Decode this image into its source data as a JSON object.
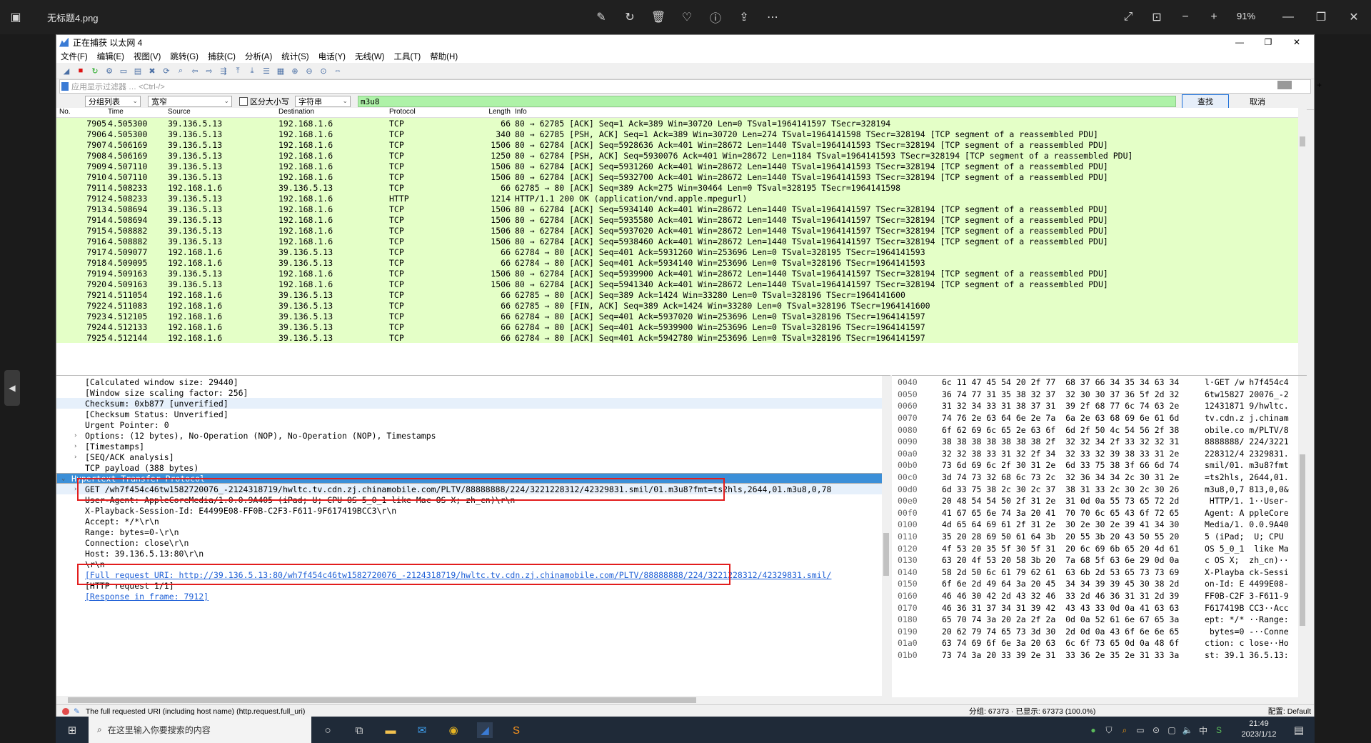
{
  "viewer": {
    "title": "无标题4.png",
    "zoom": "91%"
  },
  "window": {
    "title": "正在捕获 以太网 4"
  },
  "menu": [
    "文件(F)",
    "编辑(E)",
    "视图(V)",
    "跳转(G)",
    "捕获(C)",
    "分析(A)",
    "统计(S)",
    "电话(Y)",
    "无线(W)",
    "工具(T)",
    "帮助(H)"
  ],
  "filter": {
    "placeholder": "应用显示过滤器 … <Ctrl-/>"
  },
  "find": {
    "scope": "分组列表",
    "width": "宽窄",
    "case_label": "区分大小写",
    "type": "字符串",
    "value": "m3u8",
    "find_btn": "查找",
    "cancel_btn": "取消"
  },
  "columns": [
    "No.",
    "Time",
    "Source",
    "Destination",
    "Protocol",
    "Length",
    "Info"
  ],
  "packets": [
    [
      "7905",
      "4.505300",
      "39.136.5.13",
      "192.168.1.6",
      "TCP",
      "66",
      "80 → 62785 [ACK] Seq=1 Ack=389 Win=30720 Len=0 TSval=1964141597 TSecr=328194"
    ],
    [
      "7906",
      "4.505300",
      "39.136.5.13",
      "192.168.1.6",
      "TCP",
      "340",
      "80 → 62785 [PSH, ACK] Seq=1 Ack=389 Win=30720 Len=274 TSval=1964141598 TSecr=328194 [TCP segment of a reassembled PDU]"
    ],
    [
      "7907",
      "4.506169",
      "39.136.5.13",
      "192.168.1.6",
      "TCP",
      "1506",
      "80 → 62784 [ACK] Seq=5928636 Ack=401 Win=28672 Len=1440 TSval=1964141593 TSecr=328194 [TCP segment of a reassembled PDU]"
    ],
    [
      "7908",
      "4.506169",
      "39.136.5.13",
      "192.168.1.6",
      "TCP",
      "1250",
      "80 → 62784 [PSH, ACK] Seq=5930076 Ack=401 Win=28672 Len=1184 TSval=1964141593 TSecr=328194 [TCP segment of a reassembled PDU]"
    ],
    [
      "7909",
      "4.507110",
      "39.136.5.13",
      "192.168.1.6",
      "TCP",
      "1506",
      "80 → 62784 [ACK] Seq=5931260 Ack=401 Win=28672 Len=1440 TSval=1964141593 TSecr=328194 [TCP segment of a reassembled PDU]"
    ],
    [
      "7910",
      "4.507110",
      "39.136.5.13",
      "192.168.1.6",
      "TCP",
      "1506",
      "80 → 62784 [ACK] Seq=5932700 Ack=401 Win=28672 Len=1440 TSval=1964141593 TSecr=328194 [TCP segment of a reassembled PDU]"
    ],
    [
      "7911",
      "4.508233",
      "192.168.1.6",
      "39.136.5.13",
      "TCP",
      "66",
      "62785 → 80 [ACK] Seq=389 Ack=275 Win=30464 Len=0 TSval=328195 TSecr=1964141598"
    ],
    [
      "7912",
      "4.508233",
      "39.136.5.13",
      "192.168.1.6",
      "HTTP",
      "1214",
      "HTTP/1.1 200 OK  (application/vnd.apple.mpegurl)"
    ],
    [
      "7913",
      "4.508694",
      "39.136.5.13",
      "192.168.1.6",
      "TCP",
      "1506",
      "80 → 62784 [ACK] Seq=5934140 Ack=401 Win=28672 Len=1440 TSval=1964141597 TSecr=328194 [TCP segment of a reassembled PDU]"
    ],
    [
      "7914",
      "4.508694",
      "39.136.5.13",
      "192.168.1.6",
      "TCP",
      "1506",
      "80 → 62784 [ACK] Seq=5935580 Ack=401 Win=28672 Len=1440 TSval=1964141597 TSecr=328194 [TCP segment of a reassembled PDU]"
    ],
    [
      "7915",
      "4.508882",
      "39.136.5.13",
      "192.168.1.6",
      "TCP",
      "1506",
      "80 → 62784 [ACK] Seq=5937020 Ack=401 Win=28672 Len=1440 TSval=1964141597 TSecr=328194 [TCP segment of a reassembled PDU]"
    ],
    [
      "7916",
      "4.508882",
      "39.136.5.13",
      "192.168.1.6",
      "TCP",
      "1506",
      "80 → 62784 [ACK] Seq=5938460 Ack=401 Win=28672 Len=1440 TSval=1964141597 TSecr=328194 [TCP segment of a reassembled PDU]"
    ],
    [
      "7917",
      "4.509077",
      "192.168.1.6",
      "39.136.5.13",
      "TCP",
      "66",
      "62784 → 80 [ACK] Seq=401 Ack=5931260 Win=253696 Len=0 TSval=328195 TSecr=1964141593"
    ],
    [
      "7918",
      "4.509095",
      "192.168.1.6",
      "39.136.5.13",
      "TCP",
      "66",
      "62784 → 80 [ACK] Seq=401 Ack=5934140 Win=253696 Len=0 TSval=328196 TSecr=1964141593"
    ],
    [
      "7919",
      "4.509163",
      "39.136.5.13",
      "192.168.1.6",
      "TCP",
      "1506",
      "80 → 62784 [ACK] Seq=5939900 Ack=401 Win=28672 Len=1440 TSval=1964141597 TSecr=328194 [TCP segment of a reassembled PDU]"
    ],
    [
      "7920",
      "4.509163",
      "39.136.5.13",
      "192.168.1.6",
      "TCP",
      "1506",
      "80 → 62784 [ACK] Seq=5941340 Ack=401 Win=28672 Len=1440 TSval=1964141597 TSecr=328194 [TCP segment of a reassembled PDU]"
    ],
    [
      "7921",
      "4.511054",
      "192.168.1.6",
      "39.136.5.13",
      "TCP",
      "66",
      "62785 → 80 [ACK] Seq=389 Ack=1424 Win=33280 Len=0 TSval=328196 TSecr=1964141600"
    ],
    [
      "7922",
      "4.511083",
      "192.168.1.6",
      "39.136.5.13",
      "TCP",
      "66",
      "62785 → 80 [FIN, ACK] Seq=389 Ack=1424 Win=33280 Len=0 TSval=328196 TSecr=1964141600"
    ],
    [
      "7923",
      "4.512105",
      "192.168.1.6",
      "39.136.5.13",
      "TCP",
      "66",
      "62784 → 80 [ACK] Seq=401 Ack=5937020 Win=253696 Len=0 TSval=328196 TSecr=1964141597"
    ],
    [
      "7924",
      "4.512133",
      "192.168.1.6",
      "39.136.5.13",
      "TCP",
      "66",
      "62784 → 80 [ACK] Seq=401 Ack=5939900 Win=253696 Len=0 TSval=328196 TSecr=1964141597"
    ],
    [
      "7925",
      "4.512144",
      "192.168.1.6",
      "39.136.5.13",
      "TCP",
      "66",
      "62784 → 80 [ACK] Seq=401 Ack=5942780 Win=253696 Len=0 TSval=328196 TSecr=1964141597"
    ]
  ],
  "details": [
    {
      "indent": 1,
      "expand": "",
      "text": "[Calculated window size: 29440]"
    },
    {
      "indent": 1,
      "expand": "",
      "text": "[Window size scaling factor: 256]"
    },
    {
      "indent": 1,
      "expand": "",
      "text": "Checksum: 0xb877 [unverified]",
      "style": "hl"
    },
    {
      "indent": 1,
      "expand": "",
      "text": "[Checksum Status: Unverified]"
    },
    {
      "indent": 1,
      "expand": "",
      "text": "Urgent Pointer: 0"
    },
    {
      "indent": 1,
      "expand": ">",
      "text": "Options: (12 bytes), No-Operation (NOP), No-Operation (NOP), Timestamps"
    },
    {
      "indent": 1,
      "expand": ">",
      "text": "[Timestamps]"
    },
    {
      "indent": 1,
      "expand": ">",
      "text": "[SEQ/ACK analysis]"
    },
    {
      "indent": 1,
      "expand": "",
      "text": "TCP payload (388 bytes)"
    },
    {
      "indent": 0,
      "expand": "v",
      "text": "Hypertext Transfer Protocol",
      "style": "sel"
    },
    {
      "indent": 1,
      "expand": ">",
      "text": "GET /wh7f454c46tw1582720076_-2124318719/hwltc.tv.cdn.zj.chinamobile.com/PLTV/88888888/224/3221228312/42329831.smil/01.m3u8?fmt=ts2hls,2644,01.m3u8,0,78",
      "style": "hl"
    },
    {
      "indent": 1,
      "expand": "",
      "text": "User-Agent: AppleCoreMedia/1.0.0.9A405 (iPad; U; CPU OS 5_0_1 like Mac OS X; zh_cn)\\r\\n"
    },
    {
      "indent": 1,
      "expand": "",
      "text": "X-Playback-Session-Id: E4499E08-FF0B-C2F3-F611-9F617419BCC3\\r\\n"
    },
    {
      "indent": 1,
      "expand": "",
      "text": "Accept: */*\\r\\n"
    },
    {
      "indent": 1,
      "expand": "",
      "text": "Range: bytes=0-\\r\\n"
    },
    {
      "indent": 1,
      "expand": "",
      "text": "Connection: close\\r\\n"
    },
    {
      "indent": 1,
      "expand": "",
      "text": "Host: 39.136.5.13:80\\r\\n"
    },
    {
      "indent": 1,
      "expand": "",
      "text": "\\r\\n"
    },
    {
      "indent": 1,
      "expand": "",
      "text": "[Full request URI: http://39.136.5.13:80/wh7f454c46tw1582720076_-2124318719/hwltc.tv.cdn.zj.chinamobile.com/PLTV/88888888/224/3221228312/42329831.smil/",
      "style": "link"
    },
    {
      "indent": 1,
      "expand": "",
      "text": "[HTTP request 1/1]"
    },
    {
      "indent": 1,
      "expand": "",
      "text": "[Response in frame: 7912]",
      "style": "link"
    }
  ],
  "hex": [
    [
      "0040",
      "6c 11 47 45 54 20 2f 77  68 37 66 34 35 34 63 34",
      "l·GET /w h7f454c4"
    ],
    [
      "0050",
      "36 74 77 31 35 38 32 37  32 30 30 37 36 5f 2d 32",
      "6tw15827 20076_-2"
    ],
    [
      "0060",
      "31 32 34 33 31 38 37 31  39 2f 68 77 6c 74 63 2e",
      "12431871 9/hwltc."
    ],
    [
      "0070",
      "74 76 2e 63 64 6e 2e 7a  6a 2e 63 68 69 6e 61 6d",
      "tv.cdn.z j.chinam"
    ],
    [
      "0080",
      "6f 62 69 6c 65 2e 63 6f  6d 2f 50 4c 54 56 2f 38",
      "obile.co m/PLTV/8"
    ],
    [
      "0090",
      "38 38 38 38 38 38 38 2f  32 32 34 2f 33 32 32 31",
      "8888888/ 224/3221"
    ],
    [
      "00a0",
      "32 32 38 33 31 32 2f 34  32 33 32 39 38 33 31 2e",
      "228312/4 2329831."
    ],
    [
      "00b0",
      "73 6d 69 6c 2f 30 31 2e  6d 33 75 38 3f 66 6d 74",
      "smil/01. m3u8?fmt"
    ],
    [
      "00c0",
      "3d 74 73 32 68 6c 73 2c  32 36 34 34 2c 30 31 2e",
      "=ts2hls, 2644,01."
    ],
    [
      "00d0",
      "6d 33 75 38 2c 30 2c 37  38 31 33 2c 30 2c 30 26",
      "m3u8,0,7 813,0,0&"
    ],
    [
      "00e0",
      "20 48 54 54 50 2f 31 2e  31 0d 0a 55 73 65 72 2d",
      " HTTP/1. 1··User-"
    ],
    [
      "00f0",
      "41 67 65 6e 74 3a 20 41  70 70 6c 65 43 6f 72 65",
      "Agent: A ppleCore"
    ],
    [
      "0100",
      "4d 65 64 69 61 2f 31 2e  30 2e 30 2e 39 41 34 30",
      "Media/1. 0.0.9A40"
    ],
    [
      "0110",
      "35 20 28 69 50 61 64 3b  20 55 3b 20 43 50 55 20",
      "5 (iPad;  U; CPU "
    ],
    [
      "0120",
      "4f 53 20 35 5f 30 5f 31  20 6c 69 6b 65 20 4d 61",
      "OS 5_0_1  like Ma"
    ],
    [
      "0130",
      "63 20 4f 53 20 58 3b 20  7a 68 5f 63 6e 29 0d 0a",
      "c OS X;  zh_cn)··"
    ],
    [
      "0140",
      "58 2d 50 6c 61 79 62 61  63 6b 2d 53 65 73 73 69",
      "X-Playba ck-Sessi"
    ],
    [
      "0150",
      "6f 6e 2d 49 64 3a 20 45  34 34 39 39 45 30 38 2d",
      "on-Id: E 4499E08-"
    ],
    [
      "0160",
      "46 46 30 42 2d 43 32 46  33 2d 46 36 31 31 2d 39",
      "FF0B-C2F 3-F611-9"
    ],
    [
      "0170",
      "46 36 31 37 34 31 39 42  43 43 33 0d 0a 41 63 63",
      "F617419B CC3··Acc"
    ],
    [
      "0180",
      "65 70 74 3a 20 2a 2f 2a  0d 0a 52 61 6e 67 65 3a",
      "ept: */* ··Range:"
    ],
    [
      "0190",
      "20 62 79 74 65 73 3d 30  2d 0d 0a 43 6f 6e 6e 65",
      " bytes=0 -··Conne"
    ],
    [
      "01a0",
      "63 74 69 6f 6e 3a 20 63  6c 6f 73 65 0d 0a 48 6f",
      "ction: c lose··Ho"
    ],
    [
      "01b0",
      "73 74 3a 20 33 39 2e 31  33 36 2e 35 2e 31 33 3a",
      "st: 39.1 36.5.13:"
    ]
  ],
  "status": {
    "hint": "The full requested URI (including host name) (http.request.full_uri)",
    "counts": "分组: 67373 · 已显示: 67373 (100.0%)",
    "profile": "配置: Default"
  },
  "taskbar": {
    "search_placeholder": "在这里输入你要搜索的内容",
    "time": "21:49",
    "date": "2023/1/12",
    "lang": "中"
  },
  "colors": {
    "packet_bg": "#e4ffc7",
    "selected": "#3b8fd8",
    "find_input": "#aef2a8",
    "annot_red": "#e21d1d"
  }
}
